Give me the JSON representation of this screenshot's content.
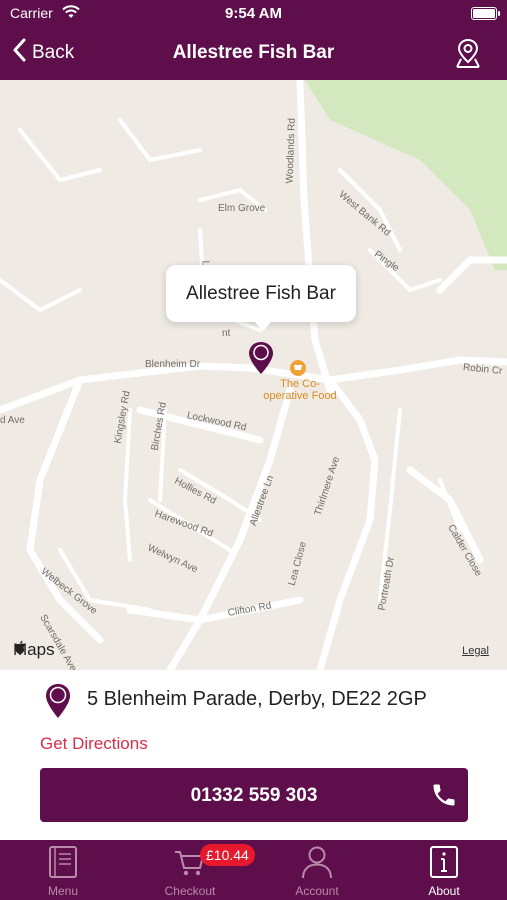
{
  "status_bar": {
    "carrier": "Carrier",
    "time": "9:54 AM"
  },
  "nav": {
    "back_label": "Back",
    "title": "Allestree Fish Bar"
  },
  "map": {
    "callout_title": "Allestree Fish Bar",
    "poi_label_line1": "The Co-",
    "poi_label_line2": "operative Food",
    "streets": {
      "woodlands_rd": "Woodlands Rd",
      "west_bank_rd": "West Bank Rd",
      "elm_grove": "Elm Grove",
      "pingle": "Pingle",
      "labu": "Labu",
      "nt": "nt",
      "blenheim_dr": "Blenheim Dr",
      "robin_cr": "Robin Cr",
      "d_ave": "d Ave",
      "lockwood_rd": "Lockwood Rd",
      "kingsley_rd": "Kingsley Rd",
      "birches_rd": "Birches Rd",
      "hollies_rd": "Hollies Rd",
      "allestree_ln": "Allestree Ln",
      "thirlmere_ave": "Thirlmere Ave",
      "harewood_rd": "Harewood Rd",
      "welwyn_ave": "Welwyn Ave",
      "lea_close": "Lea Close",
      "calder_close": "Calder Close",
      "portreath_dr": "Portreath Dr",
      "welbeck_grove": "Welbeck Grove",
      "scarsdale_ave": "Scarsdale Ave",
      "clifton_rd": "Clifton Rd"
    },
    "maps_logo": "Maps",
    "legal": "Legal"
  },
  "location": {
    "address": "5 Blenheim Parade, Derby, DE22 2GP",
    "directions_label": "Get Directions",
    "phone": "01332 559 303"
  },
  "tabs": [
    {
      "label": "Menu",
      "icon": "menu-book-icon"
    },
    {
      "label": "Checkout",
      "icon": "cart-icon",
      "badge": "£10.44"
    },
    {
      "label": "Account",
      "icon": "person-icon"
    },
    {
      "label": "About",
      "icon": "info-icon",
      "active": true
    }
  ],
  "colors": {
    "brand": "#5e0f4b",
    "accent": "#d92d4a",
    "badge": "#e8192c",
    "map_bg": "#efebe4",
    "park": "#d3e8bf"
  }
}
